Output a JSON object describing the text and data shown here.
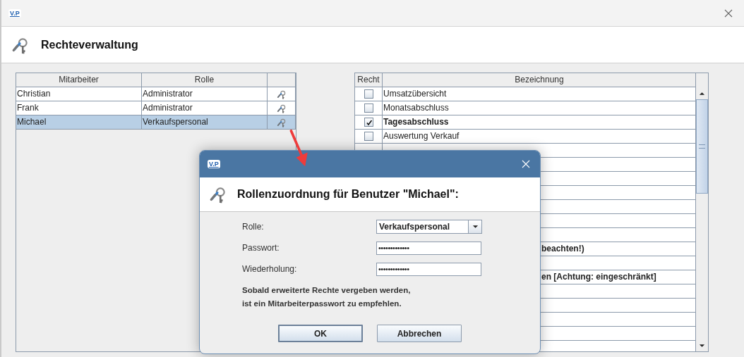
{
  "window": {
    "logo": "V.P",
    "header": "Rechteverwaltung"
  },
  "employees": {
    "columns": [
      "Mitarbeiter",
      "Rolle"
    ],
    "rows": [
      {
        "name": "Christian",
        "role": "Administrator",
        "selected": false
      },
      {
        "name": "Frank",
        "role": "Administrator",
        "selected": false
      },
      {
        "name": "Michael",
        "role": "Verkaufspersonal",
        "selected": true
      }
    ]
  },
  "rights": {
    "columns": [
      "Recht",
      "Bezeichnung"
    ],
    "rows": [
      {
        "kind": "full",
        "text": "Umsatzübersicht",
        "checked": false,
        "emphasized": false
      },
      {
        "kind": "full",
        "text": "Monatsabschluss",
        "checked": false,
        "emphasized": false
      },
      {
        "kind": "full",
        "text": "Tagesabschluss",
        "checked": true,
        "emphasized": true
      },
      {
        "kind": "full",
        "text": "Auswertung Verkauf",
        "checked": false,
        "emphasized": false
      },
      {
        "kind": "covered"
      },
      {
        "kind": "covered"
      },
      {
        "kind": "covered"
      },
      {
        "kind": "covered"
      },
      {
        "kind": "covered"
      },
      {
        "kind": "covered"
      },
      {
        "kind": "covered"
      },
      {
        "kind": "covered",
        "text": "beachten!)",
        "emphasized": true
      },
      {
        "kind": "covered"
      },
      {
        "kind": "covered",
        "text": "en [Achtung: eingeschränkt]",
        "emphasized": true
      },
      {
        "kind": "covered"
      },
      {
        "kind": "covered"
      },
      {
        "kind": "covered"
      },
      {
        "kind": "covered"
      }
    ]
  },
  "dialog": {
    "logo": "V.P",
    "title": "Rollenzuordnung für Benutzer \"Michael\":",
    "fields": [
      {
        "kind": "dropdown",
        "label": "Rolle:",
        "value": "Verkaufspersonal"
      },
      {
        "kind": "password",
        "label": "Passwort:",
        "value": "•••••••••••••"
      },
      {
        "kind": "password",
        "label": "Wiederholung:",
        "value": "•••••••••••••"
      }
    ],
    "note": [
      "Sobald erweiterte Rechte vergeben werden,",
      "ist ein Mitarbeiterpasswort zu empfehlen."
    ],
    "buttons": [
      {
        "label": "OK",
        "default": true
      },
      {
        "label": "Abbrechen",
        "default": false
      }
    ]
  }
}
